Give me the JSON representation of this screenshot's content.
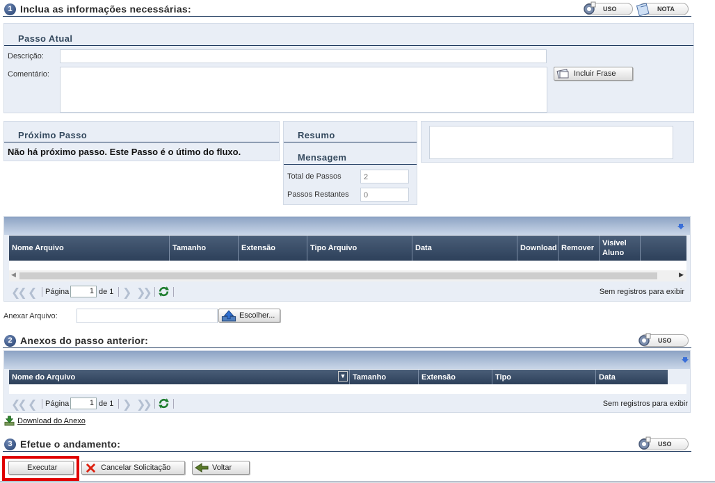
{
  "section1": {
    "number": "1",
    "title": "Inclua as informações necessárias:",
    "uso_label": "USO",
    "nota_label": "NOTA"
  },
  "passo_atual": {
    "title": "Passo Atual",
    "descricao_label": "Descrição:",
    "comentario_label": "Comentário:",
    "incluir_frase_label": "Incluir Frase"
  },
  "proximo_passo": {
    "title": "Próximo Passo",
    "message": "Não há próximo passo. Este Passo é o útimo do fluxo."
  },
  "resumo": {
    "title": "Resumo",
    "mensagem_title": "Mensagem",
    "total_passos_label": "Total de Passos",
    "total_passos_value": "2",
    "passos_restantes_label": "Passos Restantes",
    "passos_restantes_value": "0"
  },
  "grid1": {
    "columns": [
      "Nome Arquivo",
      "Tamanho",
      "Extensão",
      "Tipo Arquivo",
      "Data",
      "Download",
      "Remover",
      "Visível Aluno"
    ],
    "pagina_label": "Página",
    "page_value": "1",
    "de_label": "de 1",
    "empty_text": "Sem registros para exibir"
  },
  "anexar": {
    "label": "Anexar Arquivo:",
    "escolher_label": "Escolher..."
  },
  "section2": {
    "number": "2",
    "title": "Anexos do passo anterior:",
    "uso_label": "USO"
  },
  "grid2": {
    "columns": [
      "Nome do Arquivo",
      "Tamanho",
      "Extensão",
      "Tipo",
      "Data"
    ],
    "pagina_label": "Página",
    "page_value": "1",
    "de_label": "de 1",
    "empty_text": "Sem registros para exibir"
  },
  "download_anexo_label": "Download do Anexo",
  "section3": {
    "number": "3",
    "title": "Efetue o andamento:",
    "uso_label": "USO"
  },
  "actions": {
    "executar": "Executar",
    "cancelar": "Cancelar Solicitação",
    "voltar": "Voltar"
  },
  "colors": {
    "panel_bg": "#e9eef6",
    "header_dark": "#2d405a",
    "highlight": "#e00000"
  }
}
